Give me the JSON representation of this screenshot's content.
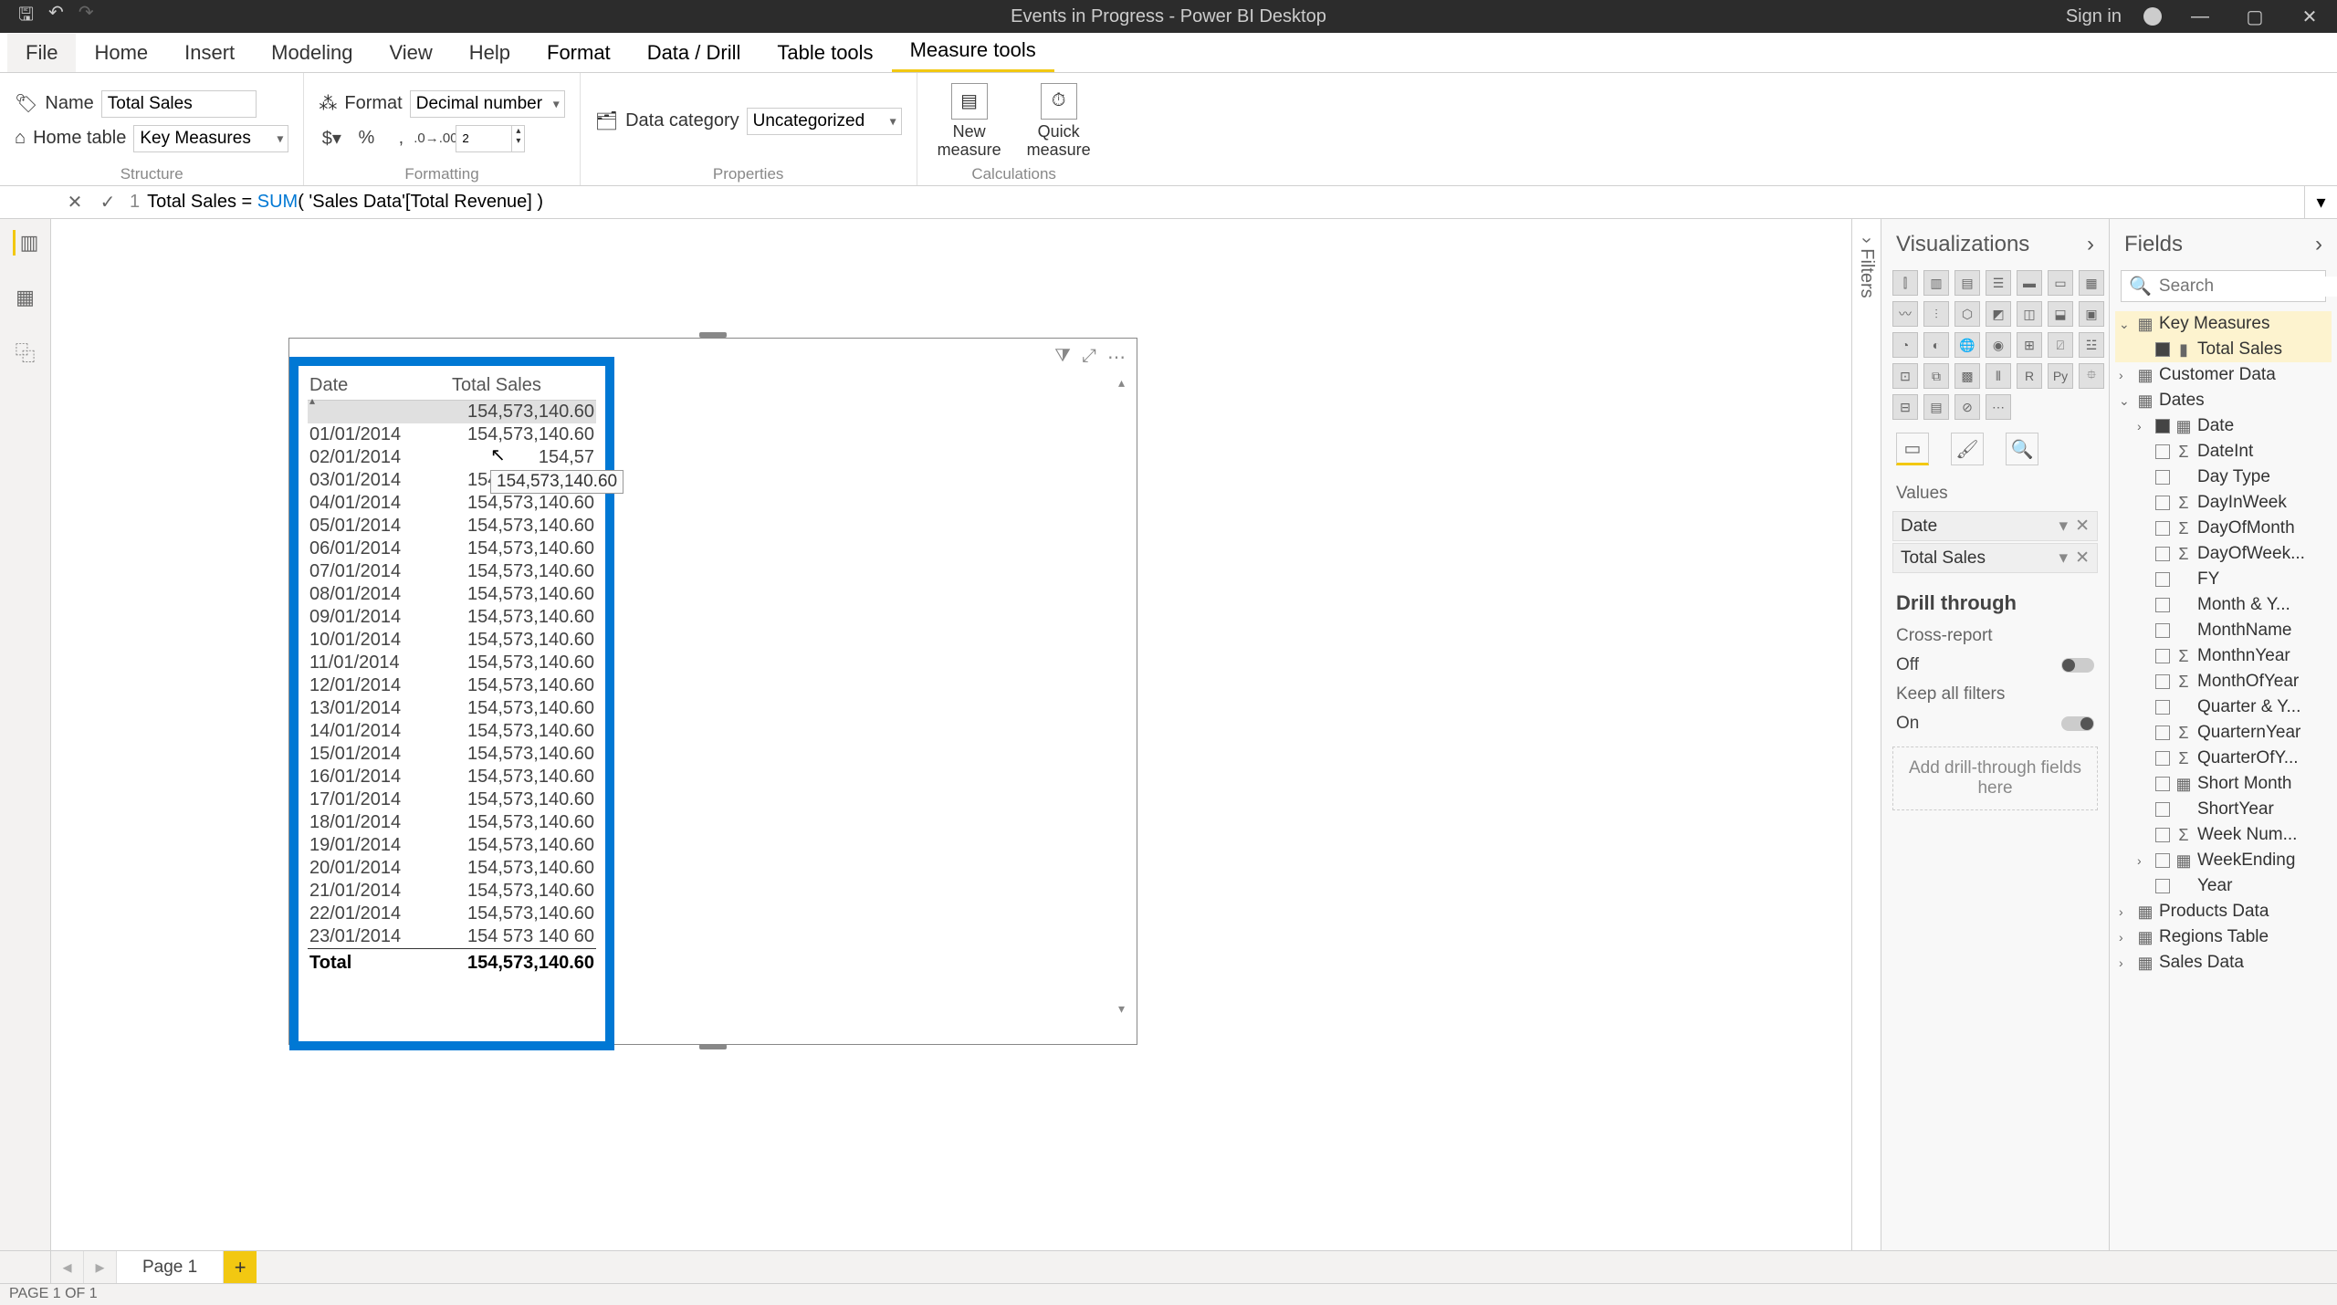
{
  "title": "Events in Progress - Power BI Desktop",
  "signin": "Sign in",
  "tabs": [
    "File",
    "Home",
    "Insert",
    "Modeling",
    "View",
    "Help",
    "Format",
    "Data / Drill",
    "Table tools",
    "Measure tools"
  ],
  "activeTab": "Measure tools",
  "structure": {
    "nameLabel": "Name",
    "nameValue": "Total Sales",
    "homeTableLabel": "Home table",
    "homeTableValue": "Key Measures",
    "groupLabel": "Structure"
  },
  "formatting": {
    "formatLabel": "Format",
    "formatValue": "Decimal number",
    "decimalValue": "2",
    "groupLabel": "Formatting"
  },
  "properties": {
    "dataCatLabel": "Data category",
    "dataCatValue": "Uncategorized",
    "groupLabel": "Properties"
  },
  "calculations": {
    "newMeasure": "New measure",
    "quickMeasure": "Quick measure",
    "groupLabel": "Calculations"
  },
  "formula": {
    "lineNo": "1",
    "left": "Total Sales = ",
    "fn": "SUM",
    "args": "( 'Sales Data'[Total Revenue] )"
  },
  "filtersLabel": "Filters",
  "visual": {
    "headerDate": "Date",
    "headerTotalSales": "Total Sales",
    "tooltip": "154,573,140.60",
    "rows": [
      {
        "date": "",
        "value": "154,573,140.60",
        "selected": true
      },
      {
        "date": "01/01/2014",
        "value": "154,573,140.60"
      },
      {
        "date": "02/01/2014",
        "value": "154,57"
      },
      {
        "date": "03/01/2014",
        "value": "154,573,140.60"
      },
      {
        "date": "04/01/2014",
        "value": "154,573,140.60"
      },
      {
        "date": "05/01/2014",
        "value": "154,573,140.60"
      },
      {
        "date": "06/01/2014",
        "value": "154,573,140.60"
      },
      {
        "date": "07/01/2014",
        "value": "154,573,140.60"
      },
      {
        "date": "08/01/2014",
        "value": "154,573,140.60"
      },
      {
        "date": "09/01/2014",
        "value": "154,573,140.60"
      },
      {
        "date": "10/01/2014",
        "value": "154,573,140.60"
      },
      {
        "date": "11/01/2014",
        "value": "154,573,140.60"
      },
      {
        "date": "12/01/2014",
        "value": "154,573,140.60"
      },
      {
        "date": "13/01/2014",
        "value": "154,573,140.60"
      },
      {
        "date": "14/01/2014",
        "value": "154,573,140.60"
      },
      {
        "date": "15/01/2014",
        "value": "154,573,140.60"
      },
      {
        "date": "16/01/2014",
        "value": "154,573,140.60"
      },
      {
        "date": "17/01/2014",
        "value": "154,573,140.60"
      },
      {
        "date": "18/01/2014",
        "value": "154,573,140.60"
      },
      {
        "date": "19/01/2014",
        "value": "154,573,140.60"
      },
      {
        "date": "20/01/2014",
        "value": "154,573,140.60"
      },
      {
        "date": "21/01/2014",
        "value": "154,573,140.60"
      },
      {
        "date": "22/01/2014",
        "value": "154,573,140.60"
      },
      {
        "date": "23/01/2014",
        "value": "154 573 140 60"
      }
    ],
    "totalLabel": "Total",
    "totalValue": "154,573,140.60"
  },
  "vizPane": {
    "title": "Visualizations",
    "valuesLabel": "Values",
    "wells": [
      {
        "name": "Date"
      },
      {
        "name": "Total Sales"
      }
    ],
    "drill": {
      "title": "Drill through",
      "crossLabel": "Cross-report",
      "crossState": "Off",
      "keepLabel": "Keep all filters",
      "keepState": "On",
      "drop": "Add drill-through fields here"
    }
  },
  "fieldsPane": {
    "title": "Fields",
    "searchPlaceholder": "Search",
    "tables": [
      {
        "name": "Key Measures",
        "expanded": true,
        "selected": true,
        "fields": [
          {
            "name": "Total Sales",
            "icon": "measure",
            "checked": true,
            "selected": true
          }
        ]
      },
      {
        "name": "Customer Data",
        "expanded": false
      },
      {
        "name": "Dates",
        "expanded": true,
        "fields": [
          {
            "name": "Date",
            "icon": "calendar",
            "checked": true,
            "caret": true
          },
          {
            "name": "DateInt",
            "icon": "sigma"
          },
          {
            "name": "Day Type",
            "icon": ""
          },
          {
            "name": "DayInWeek",
            "icon": "sigma"
          },
          {
            "name": "DayOfMonth",
            "icon": "sigma"
          },
          {
            "name": "DayOfWeek...",
            "icon": "sigma"
          },
          {
            "name": "FY",
            "icon": ""
          },
          {
            "name": "Month & Y...",
            "icon": ""
          },
          {
            "name": "MonthName",
            "icon": ""
          },
          {
            "name": "MonthnYear",
            "icon": "sigma"
          },
          {
            "name": "MonthOfYear",
            "icon": "sigma"
          },
          {
            "name": "Quarter & Y...",
            "icon": ""
          },
          {
            "name": "QuarternYear",
            "icon": "sigma"
          },
          {
            "name": "QuarterOfY...",
            "icon": "sigma"
          },
          {
            "name": "Short Month",
            "icon": "calendar"
          },
          {
            "name": "ShortYear",
            "icon": ""
          },
          {
            "name": "Week Num...",
            "icon": "sigma"
          },
          {
            "name": "WeekEnding",
            "icon": "calendar",
            "caret": true
          },
          {
            "name": "Year",
            "icon": ""
          }
        ]
      },
      {
        "name": "Products Data",
        "expanded": false
      },
      {
        "name": "Regions Table",
        "expanded": false
      },
      {
        "name": "Sales Data",
        "expanded": false
      }
    ]
  },
  "pageTab": "Page 1",
  "status": "PAGE 1 OF 1"
}
